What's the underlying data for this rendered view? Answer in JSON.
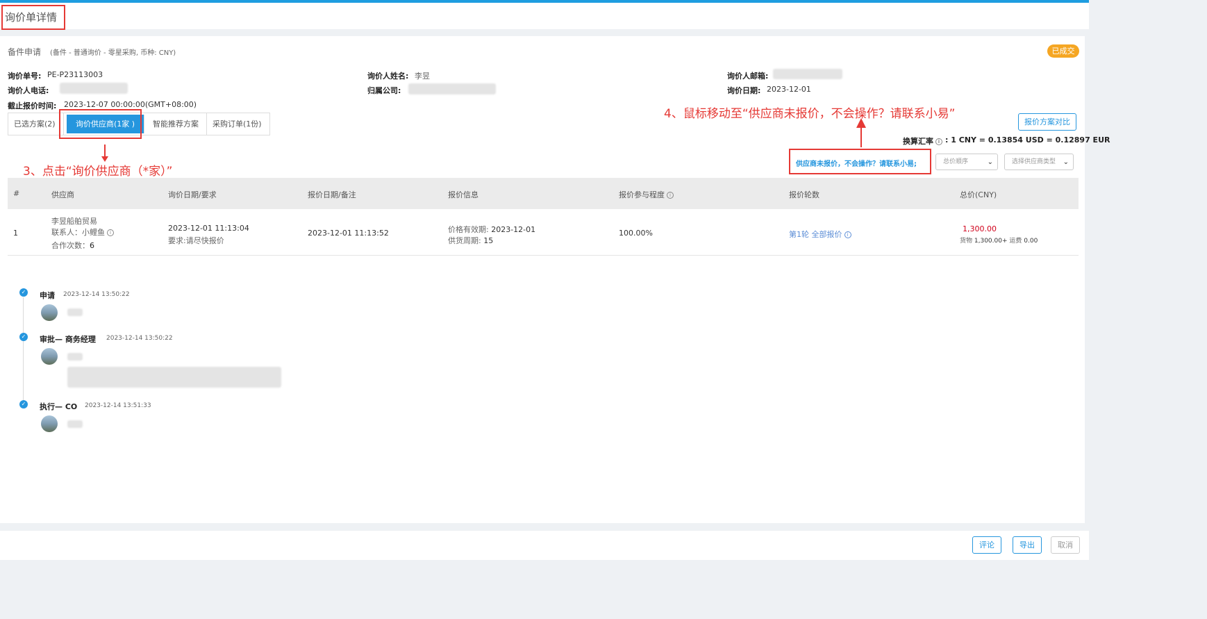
{
  "page": {
    "title": "询价单详情"
  },
  "header": {
    "section_title": "备件申请",
    "section_subtitle": "(备件 - 普通询价 - 零星采购, 币种: CNY)",
    "status_badge": "已成交"
  },
  "info": {
    "inquiry_no_label": "询价单号:",
    "inquiry_no": "PE-P23113003",
    "inquirer_name_label": "询价人姓名:",
    "inquirer_name": "李昱",
    "inquirer_email_label": "询价人邮箱:",
    "inquirer_phone_label": "询价人电话:",
    "company_label": "归属公司:",
    "inquiry_date_label": "询价日期:",
    "inquiry_date": "2023-12-01",
    "deadline_label": "截止报价时间:",
    "deadline": "2023-12-07 00:00:00(GMT+08:00)"
  },
  "tabs": [
    {
      "label": "已选方案(2)"
    },
    {
      "label": "询价供应商(1家 )"
    },
    {
      "label": "智能推荐方案"
    },
    {
      "label": "采购订单(1份)"
    }
  ],
  "toolbar": {
    "compare_button": "报价方案对比",
    "exchange_label": "换算汇率",
    "exchange_value": ": 1 CNY = 0.13854 USD = 0.12897 EUR",
    "supplier_hint": "供应商未报价，不会操作？请联系小易;",
    "sort_select": "总价顺序",
    "supplier_type_select": "选择供应商类型"
  },
  "annotations": {
    "step3": "3、点击“询价供应商（*家）”",
    "step4": "4、鼠标移动至“供应商未报价，不会操作？请联系小易”"
  },
  "table": {
    "columns": [
      "#",
      "供应商",
      "询价日期/要求",
      "报价日期/备注",
      "报价信息",
      "报价参与程度",
      "报价轮数",
      "总价(CNY)"
    ],
    "rows": [
      {
        "index": "1",
        "supplier_name": "李昱船舶贸易",
        "contact": "联系人：小鲤鱼",
        "coop_label": "合作次数：",
        "coop_count": "6",
        "inquiry_date": "2023-12-01 11:13:04",
        "requirement": "要求:请尽快报价",
        "quote_date": "2023-12-01 11:13:52",
        "validity_label": "价格有效期:",
        "validity": "2023-12-01",
        "supply_label": "供货周期:",
        "supply_days": "15",
        "participation": "100.00%",
        "rounds": "第1轮 全部报价",
        "total": "1,300.00",
        "total_detail_label": "货物",
        "total_detail_goods": "1,300.00+",
        "total_detail_freight_label": "运费",
        "total_detail_freight": "0.00"
      }
    ]
  },
  "timeline": [
    {
      "title": "申请",
      "time": "2023-12-14 13:50:22"
    },
    {
      "title": "审批— 商务经理",
      "time": "2023-12-14 13:50:22"
    },
    {
      "title": "执行— CO",
      "time": "2023-12-14 13:51:33"
    }
  ],
  "footer": {
    "comment": "评论",
    "export": "导出",
    "cancel": "取消"
  },
  "colors": {
    "primary": "#2596de",
    "annotation": "#e53935",
    "badge": "#f5a623",
    "price": "#d0021b"
  }
}
